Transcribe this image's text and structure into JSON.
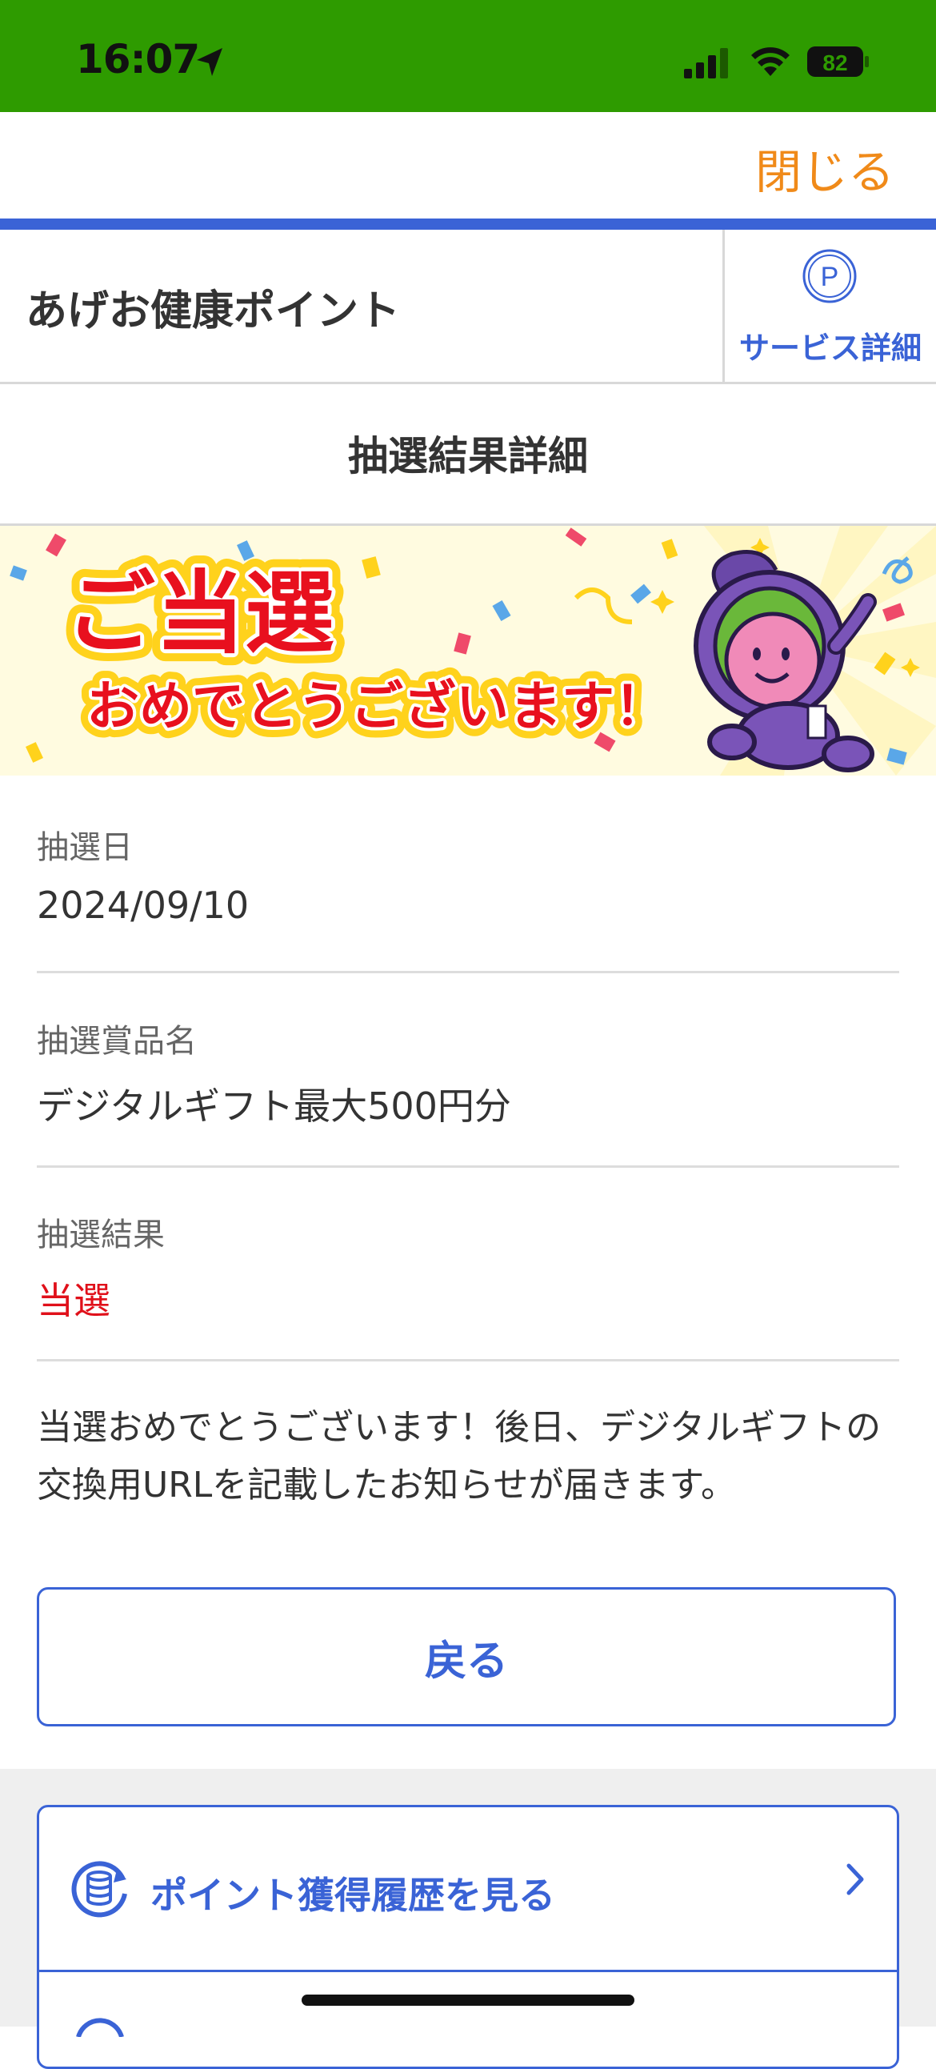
{
  "status_bar": {
    "time": "16:07",
    "battery": "82"
  },
  "close_label": "閉じる",
  "app": {
    "title": "あげお健康ポイント",
    "service_detail_label": "サービス詳細"
  },
  "page": {
    "title": "抽選結果詳細"
  },
  "banner": {
    "line1": "ご当選",
    "line2": "おめでとうございます！"
  },
  "details": {
    "date_label": "抽選日",
    "date_value": "2024/09/10",
    "prize_label": "抽選賞品名",
    "prize_value": "デジタルギフト最大500円分",
    "result_label": "抽選結果",
    "result_value": "当選"
  },
  "message": {
    "line1": "当選おめでとうございます！後日、デジタルギフトの",
    "line2": "交換用URLを記載したお知らせが届きます。"
  },
  "back_button_label": "戻る",
  "menu": {
    "items": [
      {
        "label": "ポイント獲得履歴を見る",
        "icon": "coin-stack-refresh-icon"
      }
    ]
  },
  "colors": {
    "status_bar": "#2e9b00",
    "accent_blue": "#3a63d6",
    "close_orange": "#f08a19",
    "result_red": "#e0101a"
  }
}
